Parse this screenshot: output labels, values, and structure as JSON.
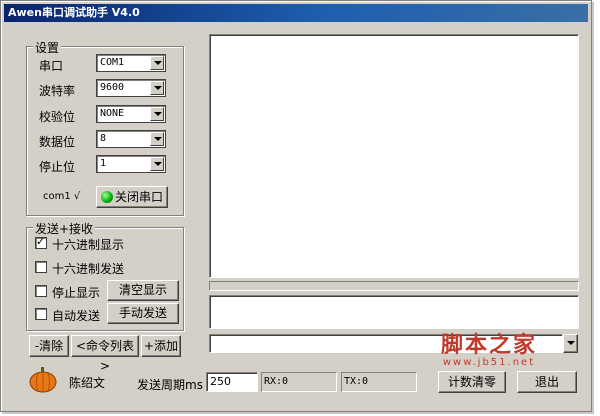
{
  "window": {
    "title": "Awen串口调试助手 V4.0"
  },
  "settings": {
    "legend": "设置",
    "port_label": "串口",
    "port_value": "COM1",
    "baud_label": "波特率",
    "baud_value": "9600",
    "parity_label": "校验位",
    "parity_value": "NONE",
    "databits_label": "数据位",
    "databits_value": "8",
    "stopbits_label": "停止位",
    "stopbits_value": "1",
    "status_text": "com1 √",
    "close_port_button": "关闭串口"
  },
  "sendrecv": {
    "legend": "发送+接收",
    "hex_display": {
      "label": "十六进制显示",
      "checked": true
    },
    "hex_send": {
      "label": "十六进制发送",
      "checked": false
    },
    "stop_display": {
      "label": "停止显示",
      "checked": false
    },
    "auto_send": {
      "label": "自动发送",
      "checked": false
    },
    "clear_display_button": "清空显示",
    "manual_send_button": "手动发送"
  },
  "cmd_bar": {
    "clear_button": "-清除",
    "list_button": "<命令列表>",
    "add_button": "+添加"
  },
  "bottom": {
    "author": "陈绍文",
    "period_label": "发送周期ms",
    "period_value": "250",
    "rx_label": "RX:0",
    "tx_label": "TX:0",
    "reset_count_button": "计数清零",
    "exit_button": "退出"
  },
  "watermark": {
    "text": "脚本之家",
    "url": "www.jb51.net"
  },
  "colors": {
    "title_bar": "#0a246a",
    "face": "#d4d0c8",
    "watermark": "#c0392b",
    "led": "#00aa00"
  }
}
